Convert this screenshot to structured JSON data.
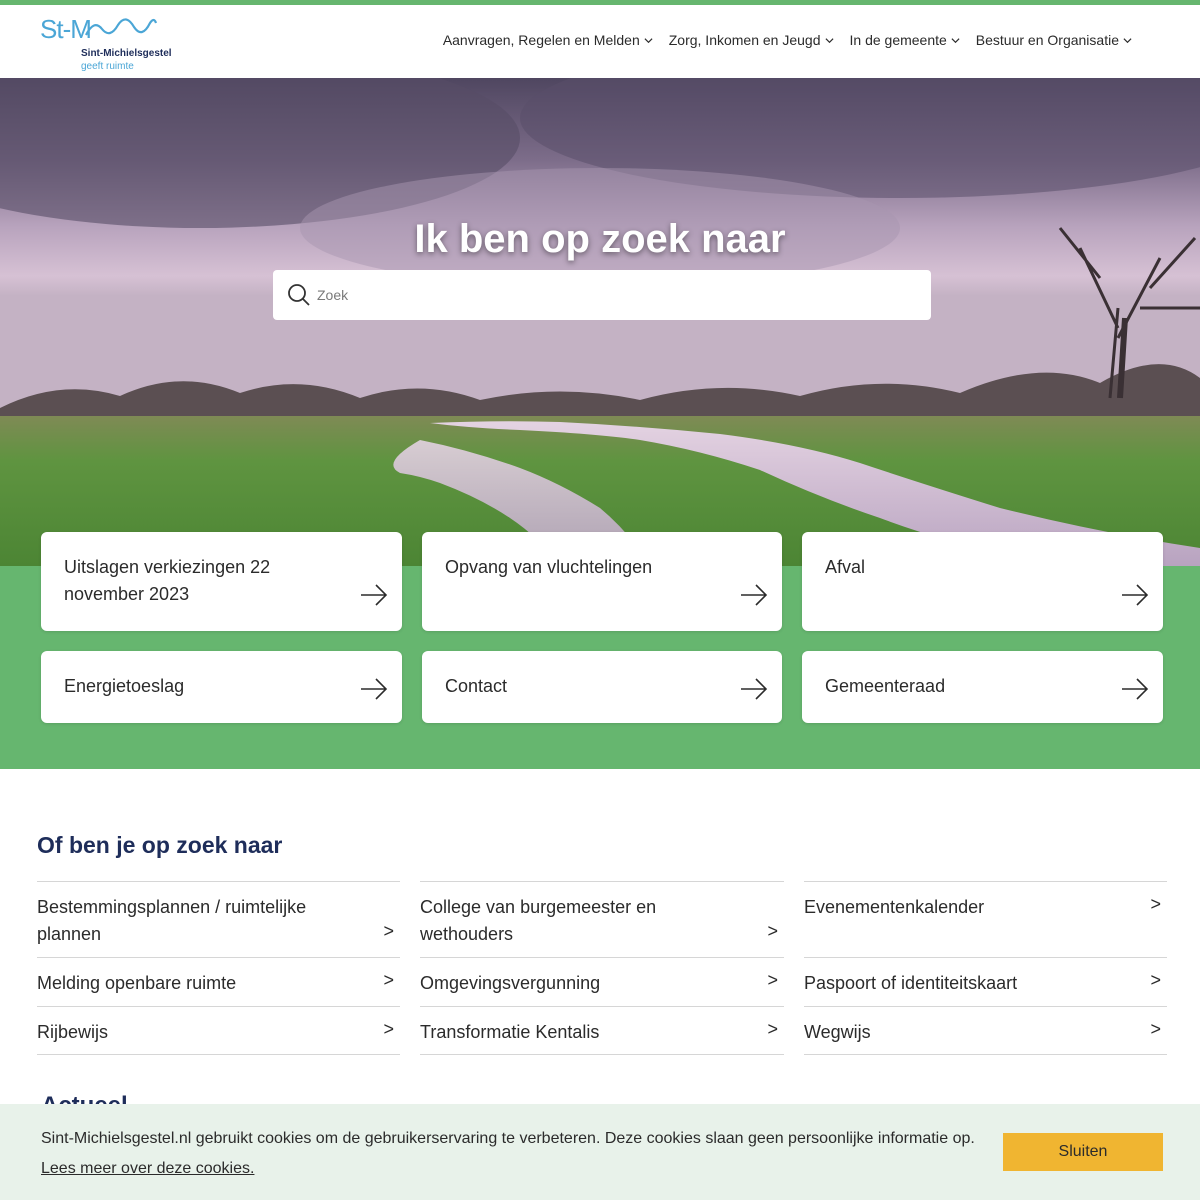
{
  "header": {
    "logo_mark": "St-M",
    "logo_name": "Sint-Michielsgestel",
    "logo_tagline": "geeft ruimte",
    "nav": [
      {
        "label": "Aanvragen, Regelen en Melden"
      },
      {
        "label": "Zorg, Inkomen en Jeugd"
      },
      {
        "label": "In de gemeente"
      },
      {
        "label": "Bestuur en Organisatie"
      }
    ]
  },
  "hero": {
    "title": "Ik ben op zoek naar",
    "search_placeholder": "Zoek"
  },
  "tiles": [
    {
      "label": "Uitslagen verkiezingen 22 november 2023"
    },
    {
      "label": "Opvang van vluchtelingen"
    },
    {
      "label": "Afval"
    },
    {
      "label": "Energietoeslag"
    },
    {
      "label": "Contact"
    },
    {
      "label": "Gemeenteraad"
    }
  ],
  "quicklinks": {
    "title": "Of ben je op zoek naar",
    "items": [
      {
        "label": "Bestemmingsplannen / ruimtelijke plannen"
      },
      {
        "label": "College van burgemeester en wethouders"
      },
      {
        "label": "Evenementenkalender"
      },
      {
        "label": "Melding openbare ruimte"
      },
      {
        "label": "Omgevingsvergunning"
      },
      {
        "label": "Paspoort of identiteitskaart"
      },
      {
        "label": "Rijbewijs"
      },
      {
        "label": "Transformatie Kentalis"
      },
      {
        "label": "Wegwijs"
      }
    ],
    "chevron": ">"
  },
  "news": {
    "title": "Actueel"
  },
  "cookie": {
    "text": "Sint-Michielsgestel.nl gebruikt cookies om de gebruikerservaring te verbeteren. Deze cookies slaan geen persoonlijke informatie op.",
    "link": "Lees meer over deze cookies.",
    "button": "Sluiten"
  },
  "colors": {
    "brand_green": "#66b66f",
    "brand_navy": "#1e2d5a",
    "brand_blue": "#4ba6d6",
    "cookie_button": "#f0b531"
  }
}
